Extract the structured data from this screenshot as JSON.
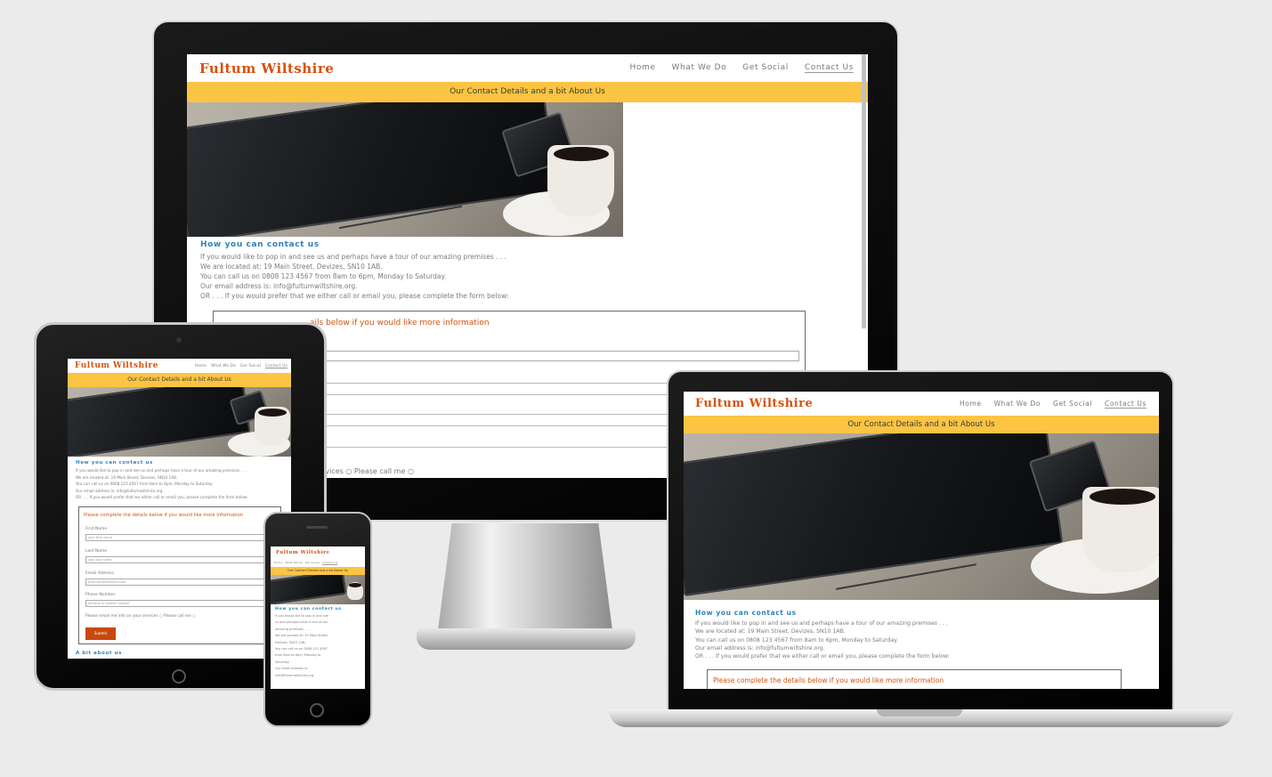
{
  "site": {
    "logo": "Fultum Wiltshire",
    "nav": [
      {
        "label": "Home"
      },
      {
        "label": "What We Do"
      },
      {
        "label": "Get Social"
      },
      {
        "label": "Contact Us",
        "active": true
      }
    ],
    "banner": "Our Contact Details and a bit About Us",
    "contact_heading": "How you can contact us",
    "lines": [
      "If you would like to pop in and see us and perhaps have a tour of our amazing premises . . .",
      "We are located at: 19 Main Street, Devizes, SN10 1AB.",
      "You can call us on 0808 123 4567 from 8am to 6pm, Monday to Saturday.",
      "Our email address is: info@fultumwiltshire.org.",
      "OR . . . If you would prefer that we either call or email you, please complete the form below:"
    ],
    "phone_lines": [
      "If you would like to pop in and see",
      "us and perhaps have a tour of our",
      "amazing premises . . .",
      "We are located at: 19 Main Street,",
      "Devizes, SN10 1AB.",
      "You can call us on 0808 123 4567",
      "from 8am to 6pm, Monday to",
      "Saturday.",
      "Our email address is:",
      "info@fultumwiltshire.org."
    ],
    "form": {
      "title": "Please complete the details below if you would like more information",
      "monitor_title_visible": "ails below if you would like more information",
      "first_name_label": "First Name",
      "first_name_placeholder": "your first name",
      "last_name_label": "Last Name",
      "last_name_placeholder": "your last name",
      "email_label": "Email Address",
      "email_placeholder": "example@example.com",
      "phone_label": "Phone Number",
      "phone_placeholder": "landline or mobile number",
      "contact_pref": "Please email me info on your services ○ Please call me ○",
      "contact_pref_monitor_visible": "services ○ Please call me ○",
      "submit": "Submit"
    },
    "about_heading": "A bit about us"
  },
  "colors": {
    "accent": "#fcc443",
    "brand": "#d4520f",
    "heading": "#2f83b7",
    "submit": "#c9470c"
  }
}
